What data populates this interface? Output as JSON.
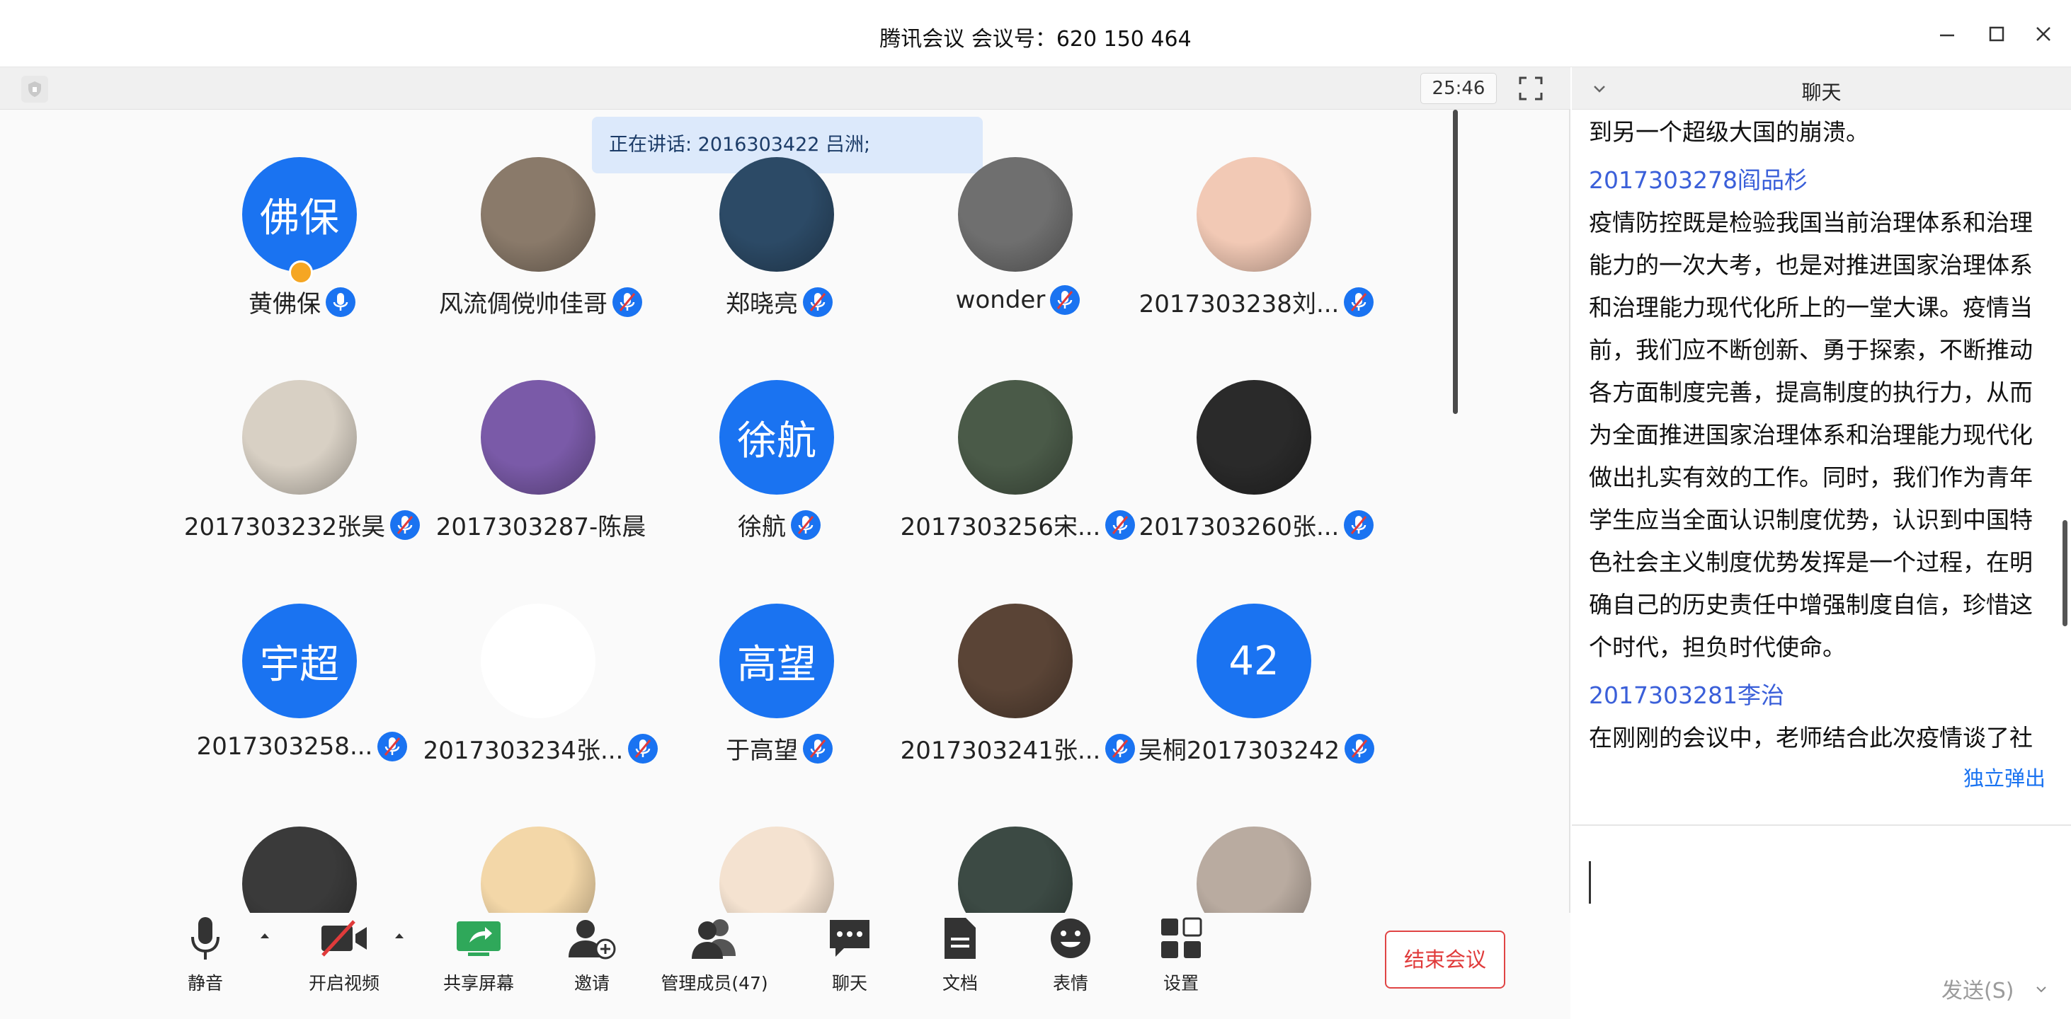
{
  "window": {
    "title": "腾讯会议 会议号：620 150 464",
    "timer": "25:46",
    "speaking": "正在讲话: 2016303422 吕洲;"
  },
  "participants": [
    {
      "name": "黄佛保",
      "avatar_text": "佛保",
      "avatar_kind": "blue",
      "mic": "on",
      "host": true
    },
    {
      "name": "风流倜傥帅佳哥",
      "avatar_text": "",
      "avatar_kind": "photo",
      "color": "#8a7a6a",
      "mic": "muted"
    },
    {
      "name": "郑晓亮",
      "avatar_text": "",
      "avatar_kind": "photo",
      "color": "#2c4a66",
      "mic": "muted"
    },
    {
      "name": "wonder",
      "avatar_text": "",
      "avatar_kind": "photo",
      "color": "#6f6f6f",
      "mic": "muted"
    },
    {
      "name": "2017303238刘...",
      "avatar_text": "",
      "avatar_kind": "photo",
      "color": "#f2c9b5",
      "mic": "muted"
    },
    {
      "name": "2017303232张昊",
      "avatar_text": "",
      "avatar_kind": "photo",
      "color": "#d8d0c4",
      "mic": "muted"
    },
    {
      "name": "2017303287-陈晨",
      "avatar_text": "",
      "avatar_kind": "photo",
      "color": "#7a5aa8",
      "mic": "none"
    },
    {
      "name": "徐航",
      "avatar_text": "徐航",
      "avatar_kind": "blue",
      "mic": "muted"
    },
    {
      "name": "2017303256宋...",
      "avatar_text": "",
      "avatar_kind": "photo",
      "color": "#4a5a48",
      "mic": "muted"
    },
    {
      "name": "2017303260张...",
      "avatar_text": "",
      "avatar_kind": "photo",
      "color": "#2a2a2a",
      "mic": "muted"
    },
    {
      "name": "2017303258...",
      "avatar_text": "宇超",
      "avatar_kind": "blue",
      "mic": "muted"
    },
    {
      "name": "2017303234张...",
      "avatar_text": "",
      "avatar_kind": "white",
      "mic": "muted"
    },
    {
      "name": "于高望",
      "avatar_text": "高望",
      "avatar_kind": "blue",
      "mic": "muted"
    },
    {
      "name": "2017303241张...",
      "avatar_text": "",
      "avatar_kind": "photo",
      "color": "#5a4436",
      "mic": "muted"
    },
    {
      "name": "吴桐2017303242",
      "avatar_text": "42",
      "avatar_kind": "blue",
      "mic": "muted"
    },
    {
      "name": "",
      "avatar_text": "",
      "avatar_kind": "photo",
      "color": "#3a3a3a",
      "mic": "none"
    },
    {
      "name": "",
      "avatar_text": "",
      "avatar_kind": "photo",
      "color": "#f3d7a8",
      "mic": "none"
    },
    {
      "name": "",
      "avatar_text": "",
      "avatar_kind": "photo",
      "color": "#f4e2d0",
      "mic": "none"
    },
    {
      "name": "",
      "avatar_text": "",
      "avatar_kind": "photo",
      "color": "#3c4a44",
      "mic": "none"
    },
    {
      "name": "",
      "avatar_text": "",
      "avatar_kind": "photo",
      "color": "#b9aba0",
      "mic": "none"
    }
  ],
  "toolbar": {
    "mute": "静音",
    "video": "开启视频",
    "share": "共享屏幕",
    "invite": "邀请",
    "members": "管理成员(47)",
    "chat": "聊天",
    "docs": "文档",
    "emoji": "表情",
    "settings": "设置",
    "end": "结束会议"
  },
  "chat": {
    "title": "聊天",
    "messages": [
      {
        "type": "text",
        "text": "到另一个超级大国的崩溃。"
      },
      {
        "type": "sender",
        "text": "2017303278阎品杉"
      },
      {
        "type": "text",
        "text": "疫情防控既是检验我国当前治理体系和治理"
      },
      {
        "type": "text",
        "text": "能力的一次大考，也是对推进国家治理体系"
      },
      {
        "type": "text",
        "text": "和治理能力现代化所上的一堂大课。疫情当"
      },
      {
        "type": "text",
        "text": "前，我们应不断创新、勇于探索，不断推动"
      },
      {
        "type": "text",
        "text": "各方面制度完善，提高制度的执行力，从而"
      },
      {
        "type": "text",
        "text": "为全面推进国家治理体系和治理能力现代化"
      },
      {
        "type": "text",
        "text": "做出扎实有效的工作。同时，我们作为青年"
      },
      {
        "type": "text",
        "text": "学生应当全面认识制度优势，认识到中国特"
      },
      {
        "type": "text",
        "text": "色社会主义制度优势发挥是一个过程，在明"
      },
      {
        "type": "text",
        "text": "确自己的历史责任中增强制度自信，珍惜这"
      },
      {
        "type": "text",
        "text": "个时代，担负时代使命。"
      },
      {
        "type": "sender",
        "text": "2017303281李治"
      },
      {
        "type": "text",
        "text": "在刚刚的会议中，老师结合此次疫情谈了社"
      }
    ],
    "popout": "独立弹出",
    "send": "发送(S)"
  },
  "colors": {
    "accent": "#1a73f1",
    "danger": "#e03b3b",
    "link": "#3a5fd9"
  }
}
